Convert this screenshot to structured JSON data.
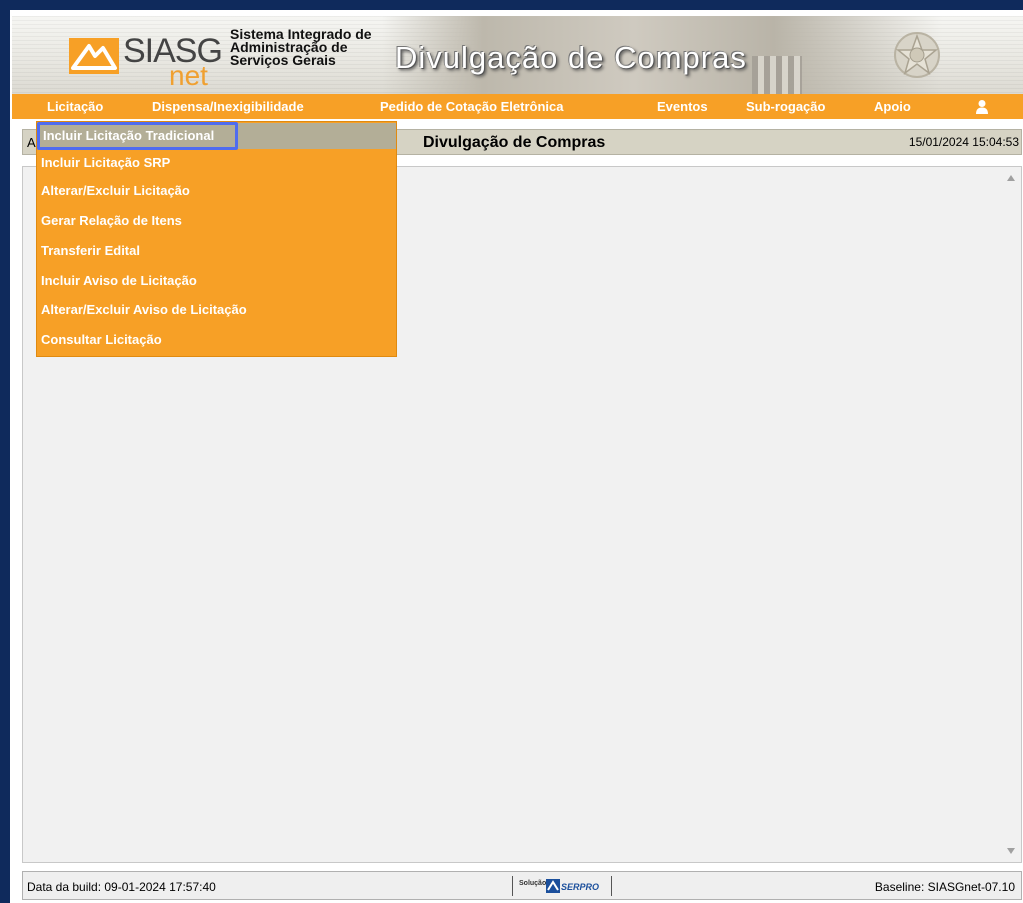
{
  "header": {
    "logo_text": "SIASG",
    "logo_sub": "net",
    "system_name_lines": [
      "Sistema Integrado de",
      "Administração de",
      "Serviços Gerais"
    ],
    "banner_title": "Divulgação de Compras"
  },
  "menubar": {
    "items": [
      {
        "label": "Licitação"
      },
      {
        "label": "Dispensa/Inexigibilidade"
      },
      {
        "label": "Pedido de Cotação Eletrônica"
      },
      {
        "label": "Eventos"
      },
      {
        "label": "Sub-rogação"
      },
      {
        "label": "Apoio"
      }
    ],
    "user_icon": "user-icon",
    "accent_color": "#f7a026"
  },
  "dropdown": {
    "items": [
      {
        "label": "Incluir Licitação Tradicional",
        "highlighted": true
      },
      {
        "label": "Incluir Licitação SRP"
      },
      {
        "label": "Alterar/Excluir Licitação"
      },
      {
        "label": "Gerar Relação de Itens"
      },
      {
        "label": "Transferir Edital"
      },
      {
        "label": "Incluir Aviso de Licitação"
      },
      {
        "label": "Alterar/Excluir Aviso de Licitação"
      },
      {
        "label": "Consultar Licitação"
      }
    ]
  },
  "titlebar": {
    "crumb": "A",
    "title": "Divulgação de Compras",
    "datetime": "15/01/2024 15:04:53"
  },
  "footer": {
    "build": "Data da build: 09-01-2024 17:57:40",
    "solution_label": "Solução",
    "solution_brand": "SERPRO",
    "baseline": "Baseline: SIASGnet-07.10"
  }
}
